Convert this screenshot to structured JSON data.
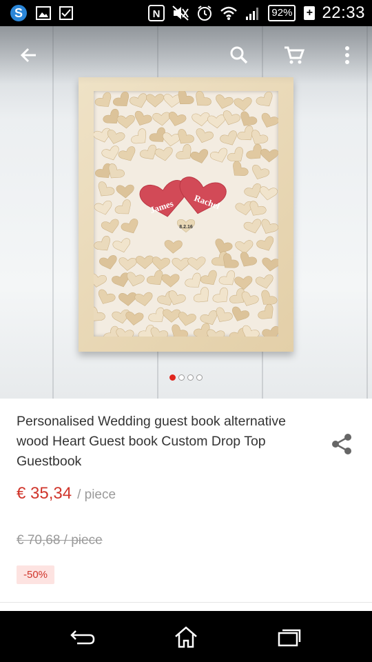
{
  "status_bar": {
    "battery_percent": "92%",
    "battery_plus": "+",
    "time": "22:33",
    "icons": [
      "skype-icon",
      "image-icon",
      "checkbox-icon",
      "nfc-icon",
      "mute-icon",
      "alarm-icon",
      "wifi-icon",
      "signal-icon",
      "battery-icon"
    ]
  },
  "toolbar": {
    "back": "back-arrow-icon",
    "search": "search-icon",
    "cart": "cart-icon",
    "more": "more-vert-icon"
  },
  "gallery": {
    "image_count": 4,
    "active_index": 0,
    "names": [
      "James",
      "Rachel"
    ],
    "date_tag": "8.2.16"
  },
  "product": {
    "title": "Personalised Wedding guest book alternative wood Heart Guest book Custom Drop Top Guestbook",
    "price": "€ 35,34",
    "unit": "/ piece",
    "original_price": "€ 70,68 / piece",
    "discount": "-50%"
  },
  "colors": {
    "accent": "#d0352b",
    "active_dot": "#e0261d",
    "discount_bg": "#fde3e1"
  },
  "nav": {
    "back": "back-icon",
    "home": "home-icon",
    "recents": "recents-icon"
  }
}
